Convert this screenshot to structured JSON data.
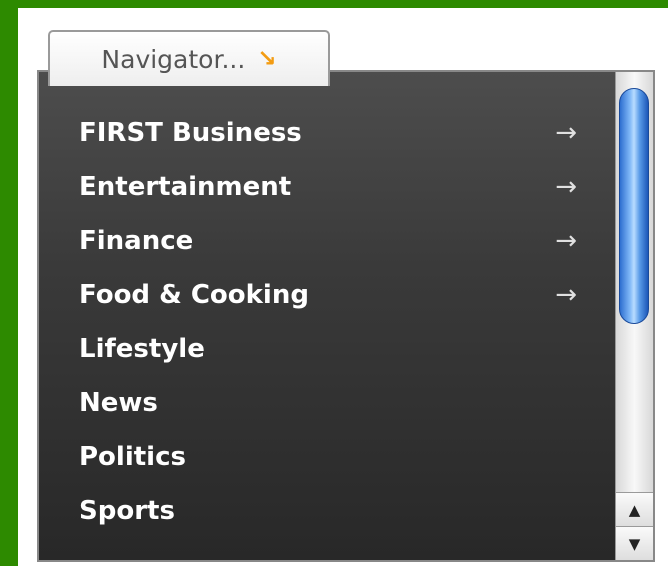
{
  "navigator": {
    "tab_label": "Navigator...",
    "tab_icon": "↘",
    "accent_color": "#f39c12"
  },
  "menu": {
    "items": [
      {
        "label": "FIRST Business",
        "has_submenu": true
      },
      {
        "label": "Entertainment",
        "has_submenu": true
      },
      {
        "label": "Finance",
        "has_submenu": true
      },
      {
        "label": "Food & Cooking",
        "has_submenu": true
      },
      {
        "label": "Lifestyle",
        "has_submenu": false
      },
      {
        "label": "News",
        "has_submenu": false
      },
      {
        "label": "Politics",
        "has_submenu": false
      },
      {
        "label": "Sports",
        "has_submenu": false
      }
    ],
    "submenu_icon": "→"
  },
  "scrollbar": {
    "up_icon": "▲",
    "down_icon": "▼"
  }
}
